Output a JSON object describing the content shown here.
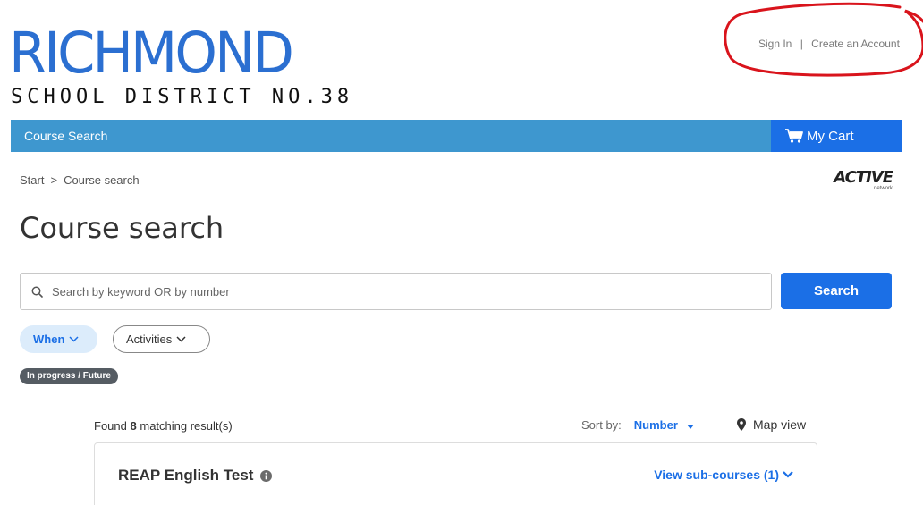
{
  "header": {
    "logo_main": "RICHMOND",
    "logo_sub": "SCHOOL DISTRICT NO.38",
    "sign_in": "Sign In",
    "separator": "|",
    "create_account": "Create an Account"
  },
  "nav": {
    "course_search": "Course Search",
    "cart_label": "My Cart"
  },
  "breadcrumb": {
    "start": "Start",
    "chevron": ">",
    "current": "Course search"
  },
  "active_logo": {
    "word": "ACTIVE",
    "sub": "network"
  },
  "page_title": "Course search",
  "search": {
    "placeholder": "Search by keyword OR by number",
    "value": "",
    "button_label": "Search"
  },
  "filters": {
    "when": "When",
    "activities": "Activities",
    "active_tag": "In progress / Future"
  },
  "results": {
    "found_prefix": "Found",
    "count": "8",
    "found_suffix": "matching result(s)",
    "sort_label": "Sort by:",
    "sort_value": "Number",
    "map_view": "Map view"
  },
  "courses": [
    {
      "title": "REAP English Test",
      "sub_courses_label": "View sub-courses (1)"
    }
  ],
  "colors": {
    "brand_blue": "#2b6fd1",
    "nav_bar": "#3e97cf",
    "primary_button": "#1b6fe6",
    "annotation_red": "#d9141c"
  }
}
